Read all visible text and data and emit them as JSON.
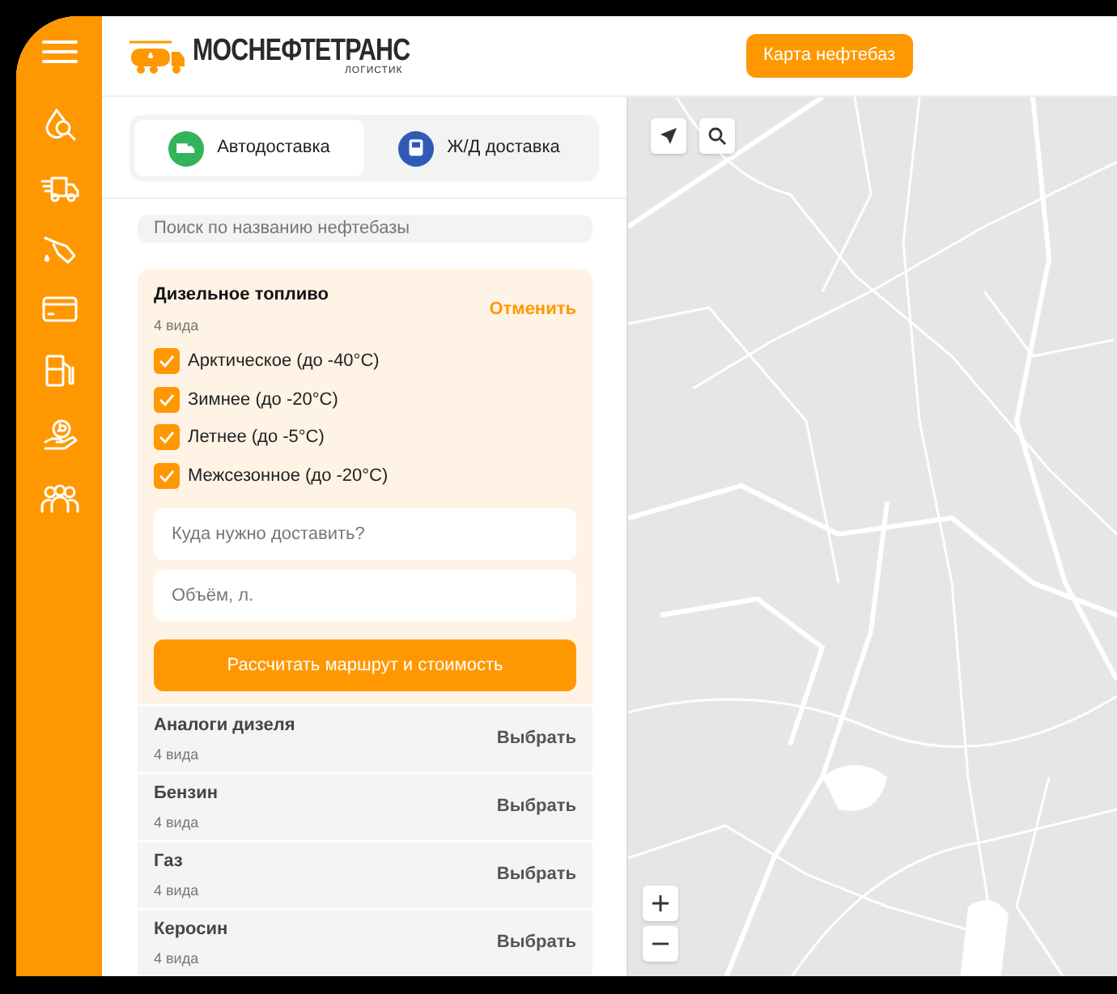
{
  "header": {
    "logo_title": "МОСНЕФТЕТРАНС",
    "logo_subtitle": "ЛОГИСТИК",
    "map_button": "Карта нефтебаз"
  },
  "tabs": [
    {
      "label": "Автодоставка",
      "kind": "truck",
      "selected": true
    },
    {
      "label": "Ж/Д доставка",
      "kind": "train",
      "selected": false
    }
  ],
  "search": {
    "placeholder": "Поиск по названию нефтебазы"
  },
  "fuel_groups": [
    {
      "title": "Дизельное топливо",
      "subtitle": "4 вида",
      "action": "Отменить",
      "expanded": true,
      "options": [
        {
          "label": "Арктическое (до -40°C)",
          "checked": true
        },
        {
          "label": "Зимнее (до -20°C)",
          "checked": true
        },
        {
          "label": "Летнее (до -5°C)",
          "checked": true
        },
        {
          "label": "Межсезонное (до -20°C)",
          "checked": true
        }
      ],
      "fields": [
        {
          "placeholder": "Куда нужно доставить?"
        },
        {
          "placeholder": "Объём, л."
        }
      ],
      "button": "Рассчитать маршрут и стоимость"
    },
    {
      "title": "Аналоги дизеля",
      "subtitle": "4 вида",
      "action": "Выбрать",
      "expanded": false
    },
    {
      "title": "Бензин",
      "subtitle": "4 вида",
      "action": "Выбрать",
      "expanded": false
    },
    {
      "title": "Газ",
      "subtitle": "4 вида",
      "action": "Выбрать",
      "expanded": false
    },
    {
      "title": "Керосин",
      "subtitle": "4 вида",
      "action": "Выбрать",
      "expanded": false
    }
  ]
}
